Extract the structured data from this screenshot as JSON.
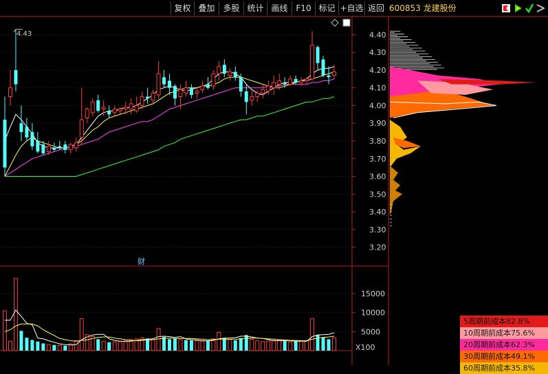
{
  "toolbar": {
    "buttons": [
      "复权",
      "叠加",
      "多股",
      "统计",
      "画线",
      "F10",
      "标记",
      "+自选",
      "返回"
    ]
  },
  "stock": {
    "code_name": "600853 龙建股份"
  },
  "icons": [
    "mark-flag-icon",
    "draw-icon",
    "checkmark-icon",
    "settings-icon"
  ],
  "finance_marker": "财",
  "colors": {
    "up": "#ff3b3b",
    "down": "#54ffff",
    "ma5": "#ffffff",
    "ma10": "#ffff44",
    "ma20": "#ff44ff",
    "ma60": "#33ff33",
    "axis": "#b02020"
  },
  "chart_data": [
    {
      "type": "candlestick",
      "y_ticks": [
        "4.40",
        "4.30",
        "4.20",
        "4.10",
        "4.00",
        "3.90",
        "3.80",
        "3.70",
        "3.60",
        "3.50",
        "3.40",
        "3.30",
        "3.20"
      ],
      "ylim": [
        3.14,
        4.46
      ],
      "annotations": [
        {
          "text": "4.43"
        }
      ],
      "candles": [
        [
          3.92,
          4.05,
          3.6,
          3.65
        ],
        [
          4.05,
          4.2,
          4.0,
          4.1
        ],
        [
          4.2,
          4.43,
          4.08,
          4.12
        ],
        [
          3.9,
          4.0,
          3.8,
          3.85
        ],
        [
          3.88,
          3.93,
          3.8,
          3.82
        ],
        [
          3.85,
          3.9,
          3.75,
          3.77
        ],
        [
          3.8,
          3.85,
          3.73,
          3.74
        ],
        [
          3.78,
          3.8,
          3.72,
          3.73
        ],
        [
          3.74,
          3.8,
          3.72,
          3.77
        ],
        [
          3.76,
          3.79,
          3.74,
          3.75
        ],
        [
          3.77,
          3.8,
          3.75,
          3.76
        ],
        [
          3.78,
          3.8,
          3.73,
          3.75
        ],
        [
          3.75,
          3.79,
          3.73,
          3.78
        ],
        [
          3.76,
          3.82,
          3.74,
          3.79
        ],
        [
          3.82,
          4.1,
          3.78,
          3.92
        ],
        [
          3.93,
          3.99,
          3.9,
          3.98
        ],
        [
          3.96,
          4.04,
          3.94,
          4.02
        ],
        [
          4.03,
          4.06,
          3.96,
          3.97
        ],
        [
          3.98,
          4.03,
          3.94,
          3.99
        ],
        [
          3.97,
          4.0,
          3.93,
          3.95
        ],
        [
          3.96,
          4.0,
          3.94,
          3.98
        ],
        [
          3.97,
          3.99,
          3.95,
          3.98
        ],
        [
          3.98,
          4.02,
          3.95,
          3.99
        ],
        [
          3.98,
          4.04,
          3.95,
          4.01
        ],
        [
          3.97,
          4.05,
          3.96,
          4.0
        ],
        [
          4.0,
          4.08,
          3.98,
          4.05
        ],
        [
          4.05,
          4.1,
          4.01,
          4.04
        ],
        [
          4.03,
          4.09,
          4.01,
          4.07
        ],
        [
          4.06,
          4.25,
          4.04,
          4.18
        ],
        [
          4.16,
          4.2,
          4.1,
          4.12
        ],
        [
          4.14,
          4.18,
          4.06,
          4.1
        ],
        [
          4.11,
          4.12,
          4.0,
          4.04
        ],
        [
          4.05,
          4.12,
          3.98,
          4.09
        ],
        [
          4.07,
          4.14,
          4.05,
          4.1
        ],
        [
          4.1,
          4.12,
          4.04,
          4.06
        ],
        [
          4.07,
          4.1,
          4.04,
          4.08
        ],
        [
          4.09,
          4.14,
          4.07,
          4.11
        ],
        [
          4.12,
          4.16,
          4.09,
          4.1
        ],
        [
          4.11,
          4.2,
          4.09,
          4.18
        ],
        [
          4.18,
          4.25,
          4.14,
          4.22
        ],
        [
          4.23,
          4.26,
          4.16,
          4.18
        ],
        [
          4.17,
          4.21,
          4.14,
          4.19
        ],
        [
          4.19,
          4.22,
          4.14,
          4.16
        ],
        [
          4.16,
          4.18,
          4.05,
          4.08
        ],
        [
          4.08,
          4.12,
          3.95,
          4.02
        ],
        [
          4.03,
          4.09,
          4.0,
          4.05
        ],
        [
          4.05,
          4.09,
          4.02,
          4.07
        ],
        [
          4.07,
          4.12,
          4.04,
          4.09
        ],
        [
          4.08,
          4.14,
          4.06,
          4.11
        ],
        [
          4.1,
          4.17,
          4.06,
          4.13
        ],
        [
          4.12,
          4.18,
          4.09,
          4.14
        ],
        [
          4.13,
          4.16,
          4.1,
          4.12
        ],
        [
          4.12,
          4.17,
          4.11,
          4.15
        ],
        [
          4.15,
          4.17,
          4.12,
          4.13
        ],
        [
          4.13,
          4.16,
          4.11,
          4.14
        ],
        [
          4.14,
          4.16,
          4.12,
          4.15
        ],
        [
          4.15,
          4.42,
          4.14,
          4.34
        ],
        [
          4.33,
          4.34,
          4.2,
          4.24
        ],
        [
          4.26,
          4.28,
          4.16,
          4.17
        ],
        [
          4.17,
          4.22,
          4.12,
          4.16
        ],
        [
          4.17,
          4.23,
          4.15,
          4.19
        ]
      ],
      "ma_series": [
        {
          "color_key": "ma5",
          "values": [
            3.8,
            3.88,
            3.95,
            3.92,
            3.88,
            3.84,
            3.79,
            3.77,
            3.76,
            3.76,
            3.76,
            3.76,
            3.77,
            3.78,
            3.82,
            3.86,
            3.9,
            3.94,
            3.96,
            3.97,
            3.97,
            3.98,
            3.99,
            3.99,
            4.0,
            4.02,
            4.04,
            4.06,
            4.09,
            4.1,
            4.11,
            4.1,
            4.09,
            4.08,
            4.09,
            4.1,
            4.11,
            4.12,
            4.15,
            4.18,
            4.19,
            4.19,
            4.18,
            4.16,
            4.12,
            4.09,
            4.07,
            4.06,
            4.08,
            4.1,
            4.12,
            4.13,
            4.13,
            4.13,
            4.14,
            4.15,
            4.18,
            4.2,
            4.21,
            4.21,
            4.22
          ]
        },
        {
          "color_key": "ma10",
          "values": [
            3.6,
            3.66,
            3.72,
            3.77,
            3.8,
            3.82,
            3.8,
            3.79,
            3.78,
            3.77,
            3.76,
            3.76,
            3.77,
            3.78,
            3.8,
            3.83,
            3.86,
            3.88,
            3.91,
            3.93,
            3.94,
            3.95,
            3.96,
            3.97,
            3.98,
            3.99,
            4.0,
            4.01,
            4.03,
            4.05,
            4.07,
            4.08,
            4.09,
            4.1,
            4.1,
            4.1,
            4.11,
            4.11,
            4.12,
            4.13,
            4.15,
            4.16,
            4.16,
            4.16,
            4.15,
            4.14,
            4.13,
            4.12,
            4.11,
            4.1,
            4.1,
            4.11,
            4.12,
            4.13,
            4.14,
            4.14,
            4.15,
            4.16,
            4.17,
            4.18,
            4.19
          ]
        },
        {
          "color_key": "ma20",
          "values": [
            3.6,
            3.62,
            3.64,
            3.66,
            3.68,
            3.7,
            3.71,
            3.72,
            3.73,
            3.74,
            3.75,
            3.75,
            3.76,
            3.77,
            3.78,
            3.79,
            3.8,
            3.81,
            3.83,
            3.85,
            3.86,
            3.87,
            3.88,
            3.89,
            3.9,
            3.91,
            3.91,
            3.92,
            3.94,
            3.96,
            3.98,
            3.99,
            4.0,
            4.01,
            4.02,
            4.03,
            4.04,
            4.05,
            4.06,
            4.07,
            4.08,
            4.09,
            4.1,
            4.1,
            4.1,
            4.1,
            4.1,
            4.1,
            4.11,
            4.11,
            4.11,
            4.12,
            4.12,
            4.12,
            4.12,
            4.12,
            4.13,
            4.13,
            4.14,
            4.14,
            4.15
          ]
        },
        {
          "color_key": "ma60",
          "values": [
            3.6,
            3.6,
            3.6,
            3.6,
            3.6,
            3.6,
            3.6,
            3.6,
            3.6,
            3.6,
            3.6,
            3.6,
            3.6,
            3.6,
            3.61,
            3.62,
            3.63,
            3.64,
            3.65,
            3.66,
            3.67,
            3.68,
            3.69,
            3.7,
            3.71,
            3.72,
            3.73,
            3.74,
            3.75,
            3.77,
            3.78,
            3.79,
            3.81,
            3.82,
            3.83,
            3.84,
            3.85,
            3.86,
            3.87,
            3.88,
            3.89,
            3.9,
            3.91,
            3.92,
            3.92,
            3.93,
            3.94,
            3.94,
            3.95,
            3.96,
            3.97,
            3.98,
            3.99,
            4.0,
            4.01,
            4.02,
            4.02,
            4.03,
            4.04,
            4.04,
            4.05
          ]
        }
      ]
    },
    {
      "type": "bar",
      "y_ticks": [
        "15000",
        "10000",
        "5000"
      ],
      "unit_label": "X100",
      "ylim": [
        0,
        19000
      ],
      "volumes": [
        10500,
        2500,
        19000,
        5200,
        3400,
        2800,
        2400,
        1900,
        1600,
        1500,
        1400,
        1300,
        1800,
        2600,
        8400,
        4200,
        3700,
        3000,
        2500,
        2200,
        2300,
        2400,
        2600,
        2900,
        3100,
        3400,
        3200,
        2900,
        5800,
        3600,
        3000,
        3200,
        2900,
        2800,
        2700,
        2600,
        2500,
        2600,
        3100,
        4800,
        3300,
        2900,
        2700,
        3300,
        4100,
        3000,
        2600,
        2400,
        2500,
        2700,
        2800,
        2500,
        2300,
        2400,
        2500,
        2600,
        8400,
        4200,
        3500,
        3000,
        3400
      ],
      "up_flags": [
        1,
        1,
        1,
        0,
        0,
        0,
        0,
        0,
        1,
        0,
        1,
        0,
        1,
        1,
        1,
        1,
        1,
        0,
        1,
        0,
        1,
        1,
        1,
        1,
        1,
        1,
        0,
        1,
        1,
        0,
        0,
        0,
        1,
        0,
        0,
        1,
        1,
        0,
        1,
        1,
        0,
        1,
        0,
        0,
        0,
        1,
        1,
        1,
        1,
        1,
        1,
        0,
        1,
        0,
        1,
        1,
        1,
        0,
        0,
        0,
        1
      ],
      "ma_lines": [
        {
          "color_key": "ma5",
          "values": [
            8000,
            8000,
            10700,
            9000,
            7200,
            6800,
            3300,
            3100,
            2600,
            2200,
            1800,
            1600,
            1500,
            1600,
            2900,
            3600,
            4100,
            4300,
            4300,
            3100,
            2700,
            2500,
            2400,
            2500,
            2700,
            2900,
            3000,
            3100,
            3700,
            3800,
            3700,
            3500,
            3700,
            3100,
            2900,
            2800,
            2600,
            2600,
            2700,
            3100,
            3300,
            3300,
            3400,
            3800,
            3800,
            3600,
            3300,
            3200,
            2900,
            2600,
            2600,
            2600,
            2600,
            2500,
            2500,
            2500,
            3700,
            4100,
            4200,
            4300,
            4700
          ]
        },
        {
          "color_key": "ma10",
          "values": [
            5000,
            5500,
            6500,
            7000,
            7000,
            7000,
            6500,
            5500,
            4700,
            4000,
            3200,
            2900,
            2600,
            2500,
            2700,
            2800,
            3200,
            3500,
            3600,
            3600,
            3300,
            3100,
            2900,
            2700,
            2600,
            2700,
            2800,
            2900,
            3100,
            3200,
            3300,
            3200,
            3200,
            3200,
            3200,
            3100,
            3000,
            2900,
            2900,
            3000,
            3000,
            3000,
            3000,
            3100,
            3200,
            3300,
            3300,
            3200,
            3100,
            3000,
            2900,
            2800,
            2700,
            2700,
            2600,
            2600,
            3000,
            3300,
            3500,
            3600,
            3800
          ]
        }
      ]
    },
    {
      "type": "area",
      "description_key": "chip_distribution",
      "price_axis_shared": true,
      "cost_legend": [
        {
          "text": "5周期前成本82.8%",
          "bg": "#e21a1a"
        },
        {
          "text": "10周期前成本75.6%",
          "bg": "#ff9aa0"
        },
        {
          "text": "20周期前成本62.3%",
          "bg": "#ff2a9d"
        },
        {
          "text": "30周期前成本49.1%",
          "bg": "#ff6a00"
        },
        {
          "text": "60周期前成本35.8%",
          "bg": "#f5b800"
        }
      ]
    }
  ]
}
